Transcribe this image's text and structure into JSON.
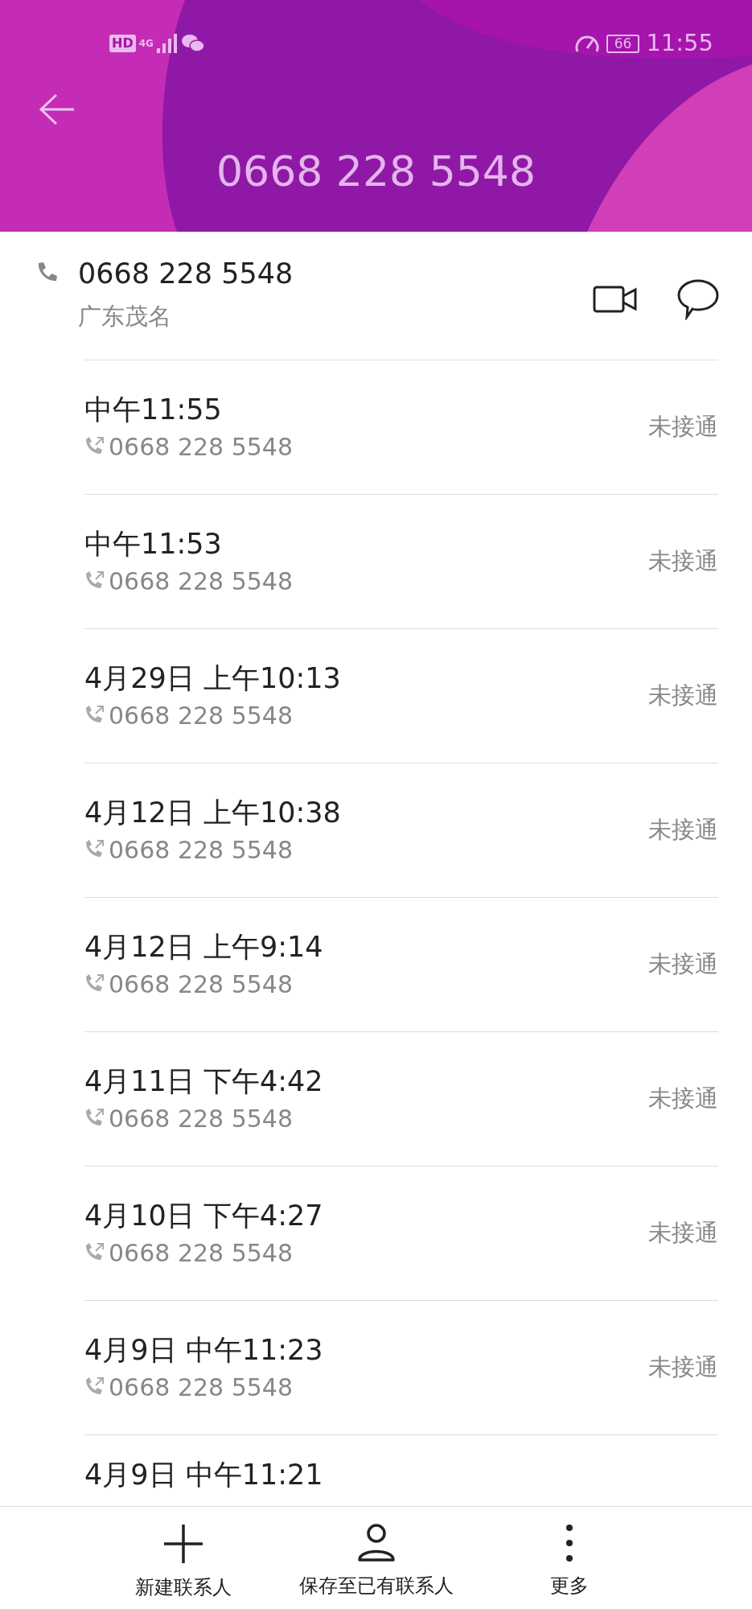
{
  "status_bar": {
    "hd": "HD",
    "network": "4G",
    "battery": "66",
    "time": "11:55"
  },
  "header": {
    "title": "0668 228 5548"
  },
  "contact": {
    "number": "0668 228 5548",
    "location": "广东茂名"
  },
  "call_log": [
    {
      "time": "中午11:55",
      "number": "0668 228 5548",
      "status": "未接通"
    },
    {
      "time": "中午11:53",
      "number": "0668 228 5548",
      "status": "未接通"
    },
    {
      "time": "4月29日 上午10:13",
      "number": "0668 228 5548",
      "status": "未接通"
    },
    {
      "time": "4月12日 上午10:38",
      "number": "0668 228 5548",
      "status": "未接通"
    },
    {
      "time": "4月12日 上午9:14",
      "number": "0668 228 5548",
      "status": "未接通"
    },
    {
      "time": "4月11日 下午4:42",
      "number": "0668 228 5548",
      "status": "未接通"
    },
    {
      "time": "4月10日 下午4:27",
      "number": "0668 228 5548",
      "status": "未接通"
    },
    {
      "time": "4月9日 中午11:23",
      "number": "0668 228 5548",
      "status": "未接通"
    },
    {
      "time": "4月9日 中午11:21"
    }
  ],
  "bottom_bar": [
    {
      "kind": "add",
      "label": "新建联系人"
    },
    {
      "kind": "person",
      "label": "保存至已有联系人"
    },
    {
      "kind": "more",
      "label": "更多"
    }
  ]
}
